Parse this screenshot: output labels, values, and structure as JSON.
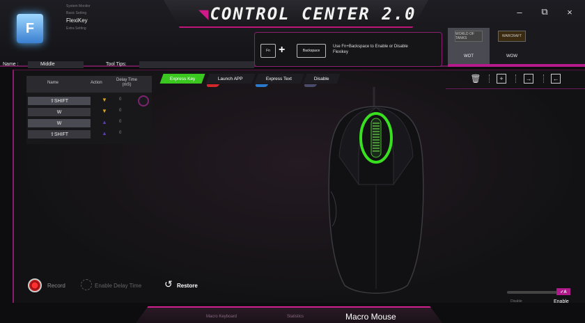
{
  "header": {
    "title": "CONTROL CENTER 2.0",
    "modules": [
      "System Monitor",
      "Basic Setting",
      "FlexiKey",
      "Extra Setting"
    ],
    "active_module_index": 2,
    "window_buttons": [
      "–",
      "⧉",
      "×"
    ]
  },
  "fn_hint": {
    "key1": "Fn",
    "key2": "Backspace",
    "text": "Use Fn+Backspace to Enable or Disable Flexikey"
  },
  "profiles": [
    {
      "label": "WOT",
      "thumb": "WORLD OF TANKS"
    },
    {
      "label": "WOW",
      "thumb": "WARCRAFT"
    }
  ],
  "name_row": {
    "name_label": "Name :",
    "name_value": "Middle",
    "tips_label": "Tool Tips:"
  },
  "macro_table": {
    "headers": {
      "name": "Name",
      "action": "Action",
      "delay": "Delay Time (mS)"
    },
    "rows": [
      {
        "key": "⇧SHIFT",
        "action": "▼",
        "delay": "0",
        "action_color": "#d9a020"
      },
      {
        "key": "W",
        "action": "▼",
        "delay": "0",
        "action_color": "#d9a020"
      },
      {
        "key": "W",
        "action": "▲",
        "delay": "0",
        "action_color": "#5a3aa8"
      },
      {
        "key": "⇧SHIFT",
        "action": "▲",
        "delay": "0",
        "action_color": "#5a3aa8"
      }
    ]
  },
  "function_tabs": [
    {
      "label": "Express Key",
      "color": "#38d020"
    },
    {
      "label": "Launch APP",
      "color": "#d0282a"
    },
    {
      "label": "Express Text",
      "color": "#2a7ad0"
    },
    {
      "label": "Disable",
      "color": "#4a4a6a"
    }
  ],
  "toolbar": [
    "trash-icon",
    "plus-box-icon",
    "export-icon",
    "import-icon"
  ],
  "bottom": {
    "record": "Record",
    "enable_delay": "Enable Delay Time",
    "restore": "Restore"
  },
  "nav": {
    "items": [
      "Macro Keyboard",
      "Statistics",
      "Macro Mouse"
    ],
    "active": "Macro Mouse"
  },
  "toggle": {
    "off_label": "Disable",
    "on_label": "Enable",
    "thumb_label": "✓A",
    "state": "Enable"
  },
  "colors": {
    "accent": "#c0157a",
    "highlight": "#38e020"
  }
}
